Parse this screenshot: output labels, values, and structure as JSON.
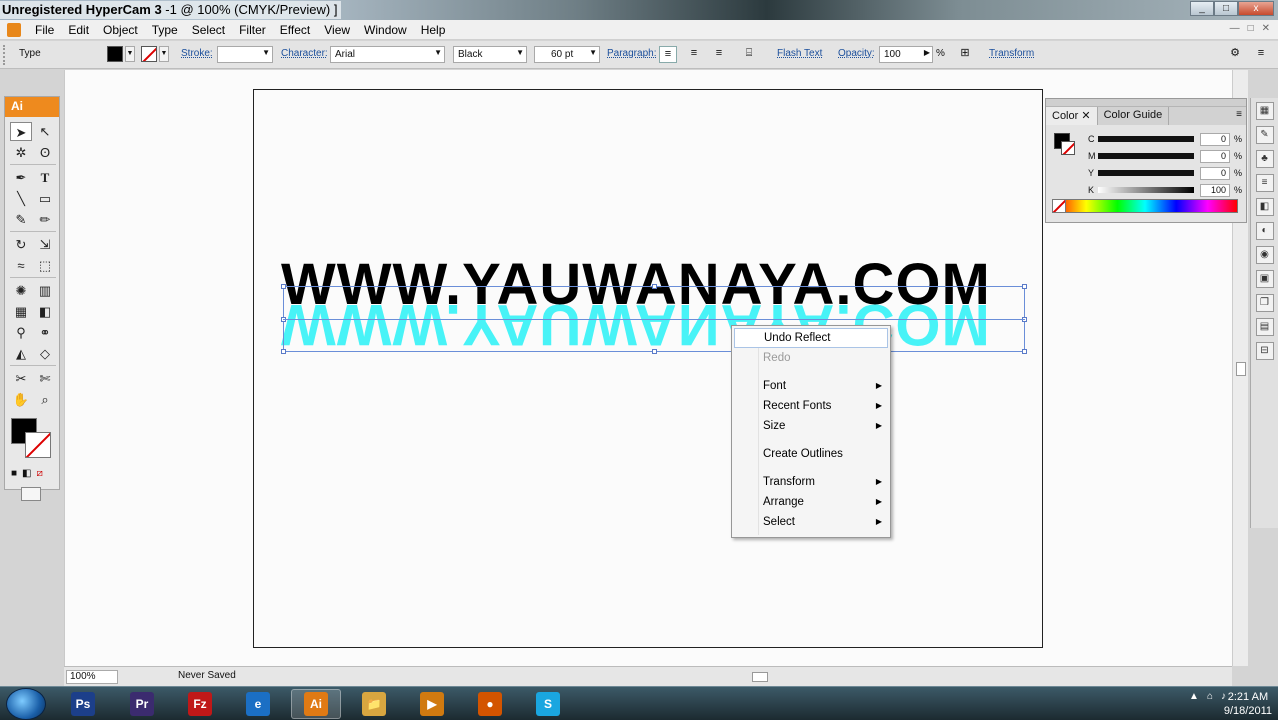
{
  "window": {
    "title_app": "Unregistered HyperCam 3",
    "title_doc": "-1 @ 100% (CMYK/Preview) ]",
    "controls": [
      "_",
      "□",
      "x"
    ]
  },
  "menu": [
    "File",
    "Edit",
    "Object",
    "Type",
    "Select",
    "Filter",
    "Effect",
    "View",
    "Window",
    "Help"
  ],
  "control_bar": {
    "mode": "Type",
    "stroke_label": "Stroke:",
    "character_label": "Character:",
    "font_family": "Arial",
    "font_style": "Black",
    "font_size": "60 pt",
    "paragraph_label": "Paragraph:",
    "flash_text_label": "Flash Text",
    "opacity_label": "Opacity:",
    "opacity_value": "100",
    "opacity_unit": "%",
    "transform_label": "Transform"
  },
  "tools_panel": {
    "logo": "Ai"
  },
  "canvas": {
    "main_text": "WWW.YAUWANAYA.COM",
    "reflected_text": "WWW.YAUWANAYA.COM",
    "reflection_color": "#3ff3f7"
  },
  "context_menu": {
    "items": [
      {
        "label": "Undo Reflect",
        "state": "highlighted",
        "submenu": false
      },
      {
        "label": "Redo",
        "state": "disabled",
        "submenu": false
      },
      {
        "label": "Font",
        "state": "normal",
        "submenu": true
      },
      {
        "label": "Recent Fonts",
        "state": "normal",
        "submenu": true
      },
      {
        "label": "Size",
        "state": "normal",
        "submenu": true
      },
      {
        "label": "Create Outlines",
        "state": "normal",
        "submenu": false
      },
      {
        "label": "Transform",
        "state": "normal",
        "submenu": true
      },
      {
        "label": "Arrange",
        "state": "normal",
        "submenu": true
      },
      {
        "label": "Select",
        "state": "normal",
        "submenu": true
      }
    ]
  },
  "color_panel": {
    "tabs": [
      "Color",
      "Color Guide"
    ],
    "sliders": [
      {
        "label": "C",
        "value": "0",
        "unit": "%"
      },
      {
        "label": "M",
        "value": "0",
        "unit": "%"
      },
      {
        "label": "Y",
        "value": "0",
        "unit": "%"
      },
      {
        "label": "K",
        "value": "100",
        "unit": "%"
      }
    ]
  },
  "status_bar": {
    "zoom": "100%",
    "save_status": "Never Saved"
  },
  "taskbar": {
    "apps": [
      {
        "label": "Ps",
        "color": "#1c3f8a"
      },
      {
        "label": "Pr",
        "color": "#3b2b6f"
      },
      {
        "label": "Fz",
        "color": "#c01818"
      },
      {
        "label": "e",
        "color": "#1b6fc4"
      },
      {
        "label": "Ai",
        "color": "#e07a14"
      },
      {
        "label": "📁",
        "color": "#d8a640"
      },
      {
        "label": "▶",
        "color": "#d07a10"
      },
      {
        "label": "●",
        "color": "#d35400"
      },
      {
        "label": "S",
        "color": "#1aa6e0"
      }
    ],
    "time": "2:21 AM",
    "date": "9/18/2011"
  }
}
